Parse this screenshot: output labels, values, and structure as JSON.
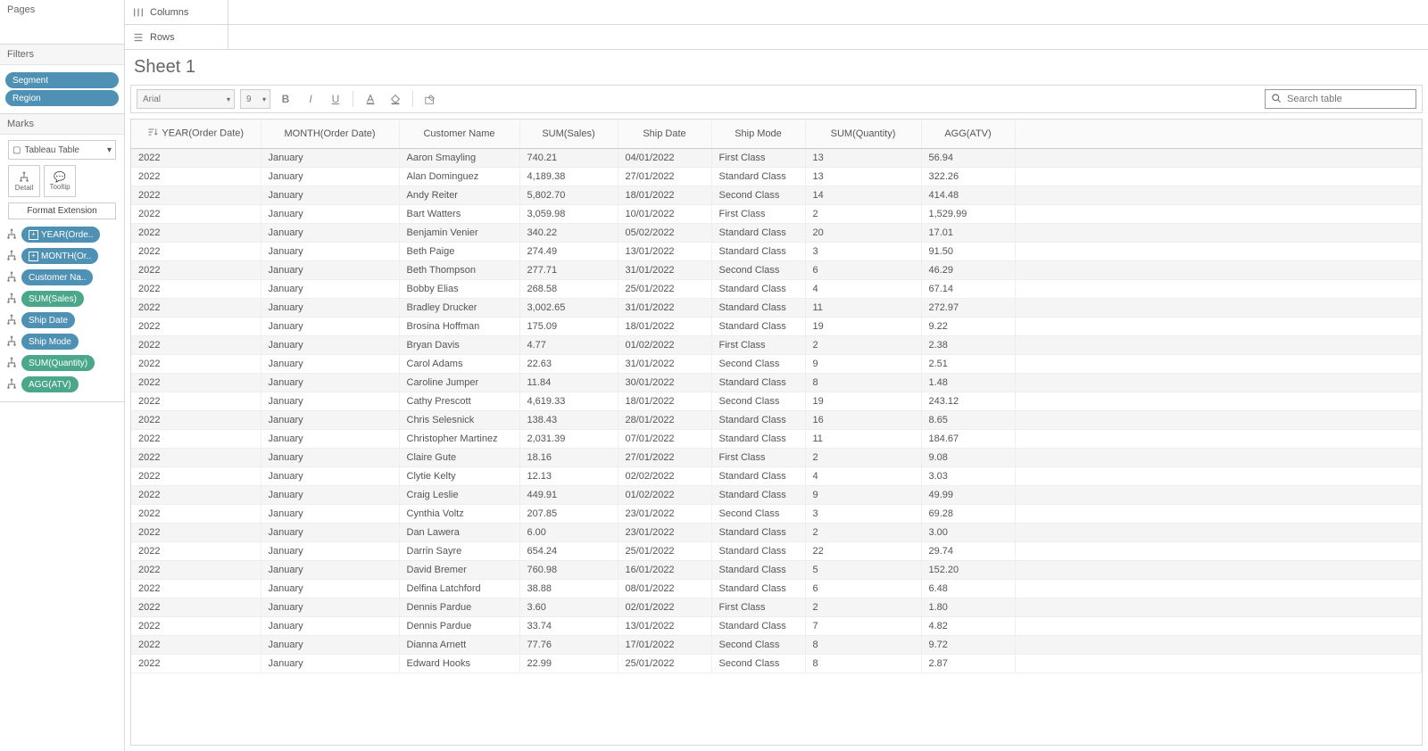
{
  "side": {
    "pages_label": "Pages",
    "filters_label": "Filters",
    "filters": [
      "Segment",
      "Region"
    ],
    "marks_label": "Marks",
    "marks_type": "Tableau Table",
    "detail_label": "Detail",
    "tooltip_label": "Tooltip",
    "format_ext": "Format Extension",
    "fields": [
      {
        "label": "YEAR(Orde..",
        "color": "blue",
        "expand": "+"
      },
      {
        "label": "MONTH(Or..",
        "color": "blue",
        "expand": "+"
      },
      {
        "label": "Customer Na..",
        "color": "blue",
        "expand": ""
      },
      {
        "label": "SUM(Sales)",
        "color": "green",
        "expand": ""
      },
      {
        "label": "Ship Date",
        "color": "blue",
        "expand": ""
      },
      {
        "label": "Ship Mode",
        "color": "blue",
        "expand": ""
      },
      {
        "label": "SUM(Quantity)",
        "color": "green",
        "expand": ""
      },
      {
        "label": "AGG(ATV)",
        "color": "green",
        "expand": ""
      }
    ]
  },
  "shelves": {
    "columns_label": "Columns",
    "rows_label": "Rows"
  },
  "sheet_title": "Sheet 1",
  "toolbar": {
    "font": "Arial",
    "size": "9",
    "search_placeholder": "Search table"
  },
  "table": {
    "headers": [
      "YEAR(Order Date)",
      "MONTH(Order Date)",
      "Customer Name",
      "SUM(Sales)",
      "Ship Date",
      "Ship Mode",
      "SUM(Quantity)",
      "AGG(ATV)"
    ],
    "rows": [
      [
        "2022",
        "January",
        "Aaron Smayling",
        "740.21",
        "04/01/2022",
        "First Class",
        "13",
        "56.94"
      ],
      [
        "2022",
        "January",
        "Alan Dominguez",
        "4,189.38",
        "27/01/2022",
        "Standard Class",
        "13",
        "322.26"
      ],
      [
        "2022",
        "January",
        "Andy Reiter",
        "5,802.70",
        "18/01/2022",
        "Second Class",
        "14",
        "414.48"
      ],
      [
        "2022",
        "January",
        "Bart Watters",
        "3,059.98",
        "10/01/2022",
        "First Class",
        "2",
        "1,529.99"
      ],
      [
        "2022",
        "January",
        "Benjamin Venier",
        "340.22",
        "05/02/2022",
        "Standard Class",
        "20",
        "17.01"
      ],
      [
        "2022",
        "January",
        "Beth Paige",
        "274.49",
        "13/01/2022",
        "Standard Class",
        "3",
        "91.50"
      ],
      [
        "2022",
        "January",
        "Beth Thompson",
        "277.71",
        "31/01/2022",
        "Second Class",
        "6",
        "46.29"
      ],
      [
        "2022",
        "January",
        "Bobby Elias",
        "268.58",
        "25/01/2022",
        "Standard Class",
        "4",
        "67.14"
      ],
      [
        "2022",
        "January",
        "Bradley Drucker",
        "3,002.65",
        "31/01/2022",
        "Standard Class",
        "11",
        "272.97"
      ],
      [
        "2022",
        "January",
        "Brosina Hoffman",
        "175.09",
        "18/01/2022",
        "Standard Class",
        "19",
        "9.22"
      ],
      [
        "2022",
        "January",
        "Bryan Davis",
        "4.77",
        "01/02/2022",
        "First Class",
        "2",
        "2.38"
      ],
      [
        "2022",
        "January",
        "Carol Adams",
        "22.63",
        "31/01/2022",
        "Second Class",
        "9",
        "2.51"
      ],
      [
        "2022",
        "January",
        "Caroline Jumper",
        "11.84",
        "30/01/2022",
        "Standard Class",
        "8",
        "1.48"
      ],
      [
        "2022",
        "January",
        "Cathy Prescott",
        "4,619.33",
        "18/01/2022",
        "Second Class",
        "19",
        "243.12"
      ],
      [
        "2022",
        "January",
        "Chris Selesnick",
        "138.43",
        "28/01/2022",
        "Standard Class",
        "16",
        "8.65"
      ],
      [
        "2022",
        "January",
        "Christopher Martinez",
        "2,031.39",
        "07/01/2022",
        "Standard Class",
        "11",
        "184.67"
      ],
      [
        "2022",
        "January",
        "Claire Gute",
        "18.16",
        "27/01/2022",
        "First Class",
        "2",
        "9.08"
      ],
      [
        "2022",
        "January",
        "Clytie Kelty",
        "12.13",
        "02/02/2022",
        "Standard Class",
        "4",
        "3.03"
      ],
      [
        "2022",
        "January",
        "Craig Leslie",
        "449.91",
        "01/02/2022",
        "Standard Class",
        "9",
        "49.99"
      ],
      [
        "2022",
        "January",
        "Cynthia Voltz",
        "207.85",
        "23/01/2022",
        "Second Class",
        "3",
        "69.28"
      ],
      [
        "2022",
        "January",
        "Dan Lawera",
        "6.00",
        "23/01/2022",
        "Standard Class",
        "2",
        "3.00"
      ],
      [
        "2022",
        "January",
        "Darrin Sayre",
        "654.24",
        "25/01/2022",
        "Standard Class",
        "22",
        "29.74"
      ],
      [
        "2022",
        "January",
        "David Bremer",
        "760.98",
        "16/01/2022",
        "Standard Class",
        "5",
        "152.20"
      ],
      [
        "2022",
        "January",
        "Delfina Latchford",
        "38.88",
        "08/01/2022",
        "Standard Class",
        "6",
        "6.48"
      ],
      [
        "2022",
        "January",
        "Dennis Pardue",
        "3.60",
        "02/01/2022",
        "First Class",
        "2",
        "1.80"
      ],
      [
        "2022",
        "January",
        "Dennis Pardue",
        "33.74",
        "13/01/2022",
        "Standard Class",
        "7",
        "4.82"
      ],
      [
        "2022",
        "January",
        "Dianna Arnett",
        "77.76",
        "17/01/2022",
        "Second Class",
        "8",
        "9.72"
      ],
      [
        "2022",
        "January",
        "Edward Hooks",
        "22.99",
        "25/01/2022",
        "Second Class",
        "8",
        "2.87"
      ]
    ]
  }
}
